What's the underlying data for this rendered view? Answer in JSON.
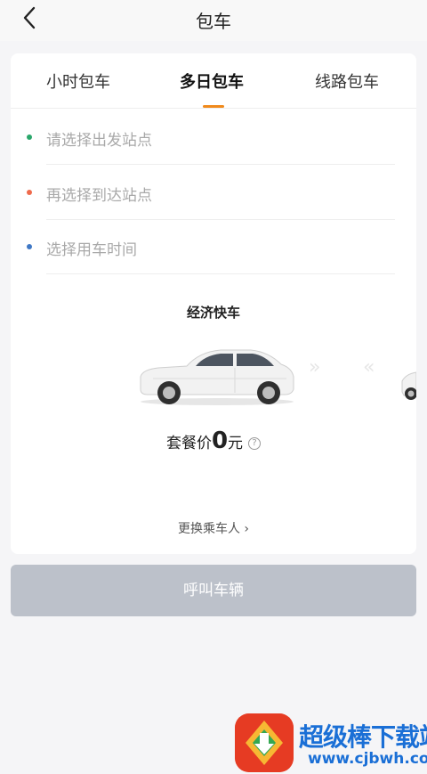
{
  "nav": {
    "title": "包车"
  },
  "tabs": [
    {
      "label": "小时包车",
      "active": false
    },
    {
      "label": "多日包车",
      "active": true
    },
    {
      "label": "线路包车",
      "active": false
    }
  ],
  "fields": [
    {
      "placeholder": "请选择出发站点",
      "dot_color": "#2aa76b"
    },
    {
      "placeholder": "再选择到达站点",
      "dot_color": "#ef6a4c"
    },
    {
      "placeholder": "选择用车时间",
      "dot_color": "#3f78c5"
    }
  ],
  "vehicle": {
    "title": "经济快车",
    "price_label": "套餐价",
    "price_value": "0",
    "price_unit": "元",
    "help_icon": "?"
  },
  "change_passenger": {
    "label": "更换乘车人",
    "chevron": "›"
  },
  "call_button": {
    "label": "呼叫车辆"
  },
  "watermark": {
    "text1": "超级棒下载站",
    "text2": "www.cjbwh.com"
  },
  "colors": {
    "accent": "#f08a1c",
    "button_disabled": "#bcc1ca"
  }
}
